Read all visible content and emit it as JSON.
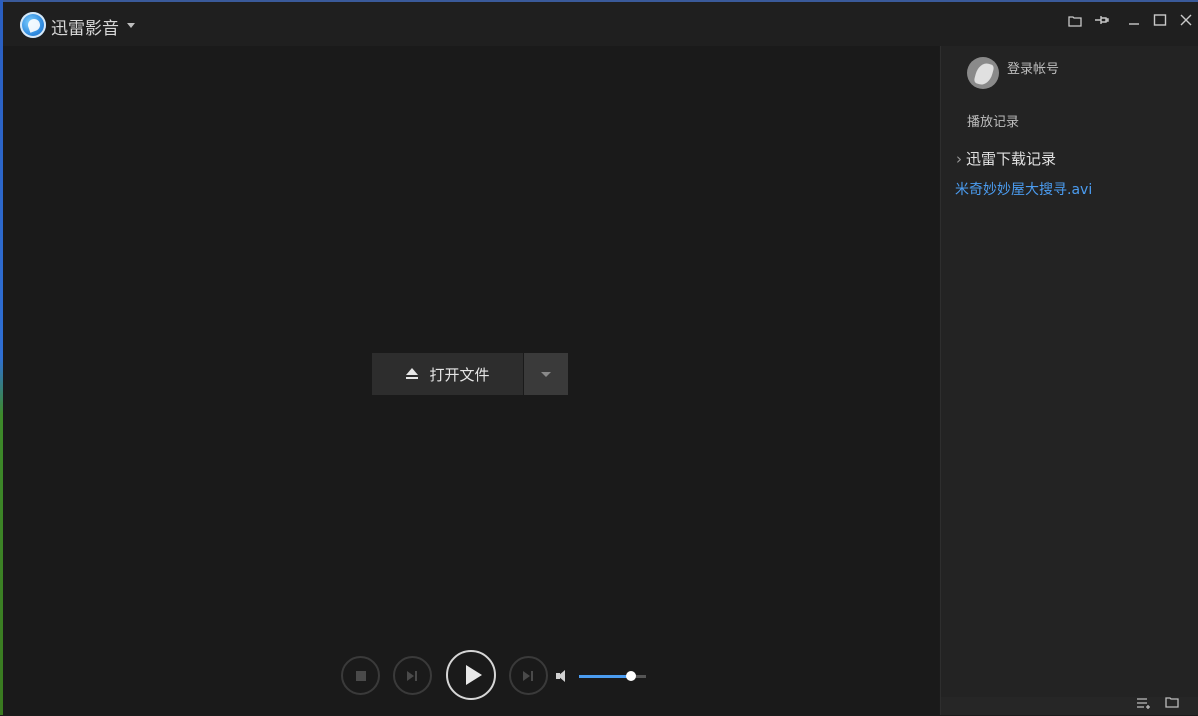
{
  "app": {
    "title": "迅雷影音"
  },
  "titlebar_icons": [
    "folder-icon",
    "pin-icon",
    "minimize-icon",
    "maximize-icon",
    "close-icon"
  ],
  "main": {
    "open_file_label": "打开文件"
  },
  "controls": {
    "volume_level": 0.78
  },
  "sidebar": {
    "login_label": "登录帐号",
    "history_label": "播放记录",
    "download_section_label": "迅雷下载记录",
    "download_items": [
      "米奇妙妙屋大搜寻.avi"
    ]
  },
  "colors": {
    "background": "#1a1a1a",
    "sidebar": "#232323",
    "accent": "#4b9cf0"
  }
}
